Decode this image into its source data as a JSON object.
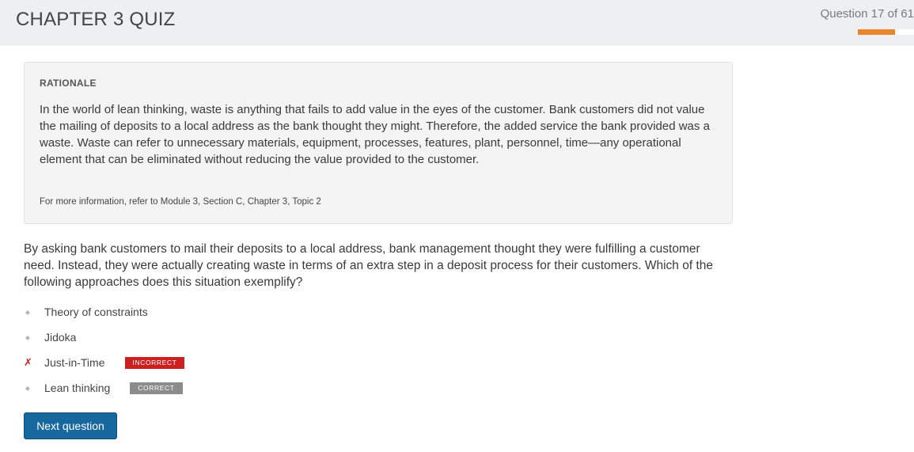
{
  "header": {
    "title": "CHAPTER 3 QUIZ",
    "progress_text": "Question 17 of 61",
    "progress_fraction": 0.66,
    "progress_color": "#e8862b"
  },
  "rationale": {
    "heading": "RATIONALE",
    "body": "In the world of lean thinking, waste is anything that fails to add value in the eyes of the customer. Bank customers did not value the mailing of deposits to a local address as the bank thought they might. Therefore, the added service the bank provided was a waste. Waste can refer to unnecessary materials, equipment, processes, features, plant, personnel, time—any operational element that can be eliminated without reducing the value provided to the customer.",
    "reference": "For more information, refer to Module 3, Section C, Chapter 3, Topic 2"
  },
  "question": {
    "text": "By asking bank customers to mail their deposits to a local address, bank management thought they were fulfilling a customer need. Instead, they were actually creating waste in terms of an extra step in a deposit process for their customers. Which of the following approaches does this situation exemplify?"
  },
  "answers": [
    {
      "label": "Theory of constraints",
      "marker_icon": "diamond-bullet-icon",
      "status": ""
    },
    {
      "label": "Jidoka",
      "marker_icon": "diamond-bullet-icon",
      "status": ""
    },
    {
      "label": "Just-in-Time",
      "marker_icon": "x-mark-icon",
      "status": "INCORRECT"
    },
    {
      "label": "Lean thinking",
      "marker_icon": "diamond-bullet-icon",
      "status": "CORRECT"
    }
  ],
  "actions": {
    "next_label": "Next question",
    "next_color": "#17689e"
  },
  "colors": {
    "incorrect": "#cc1f1f",
    "correct": "#8c8c8c"
  }
}
